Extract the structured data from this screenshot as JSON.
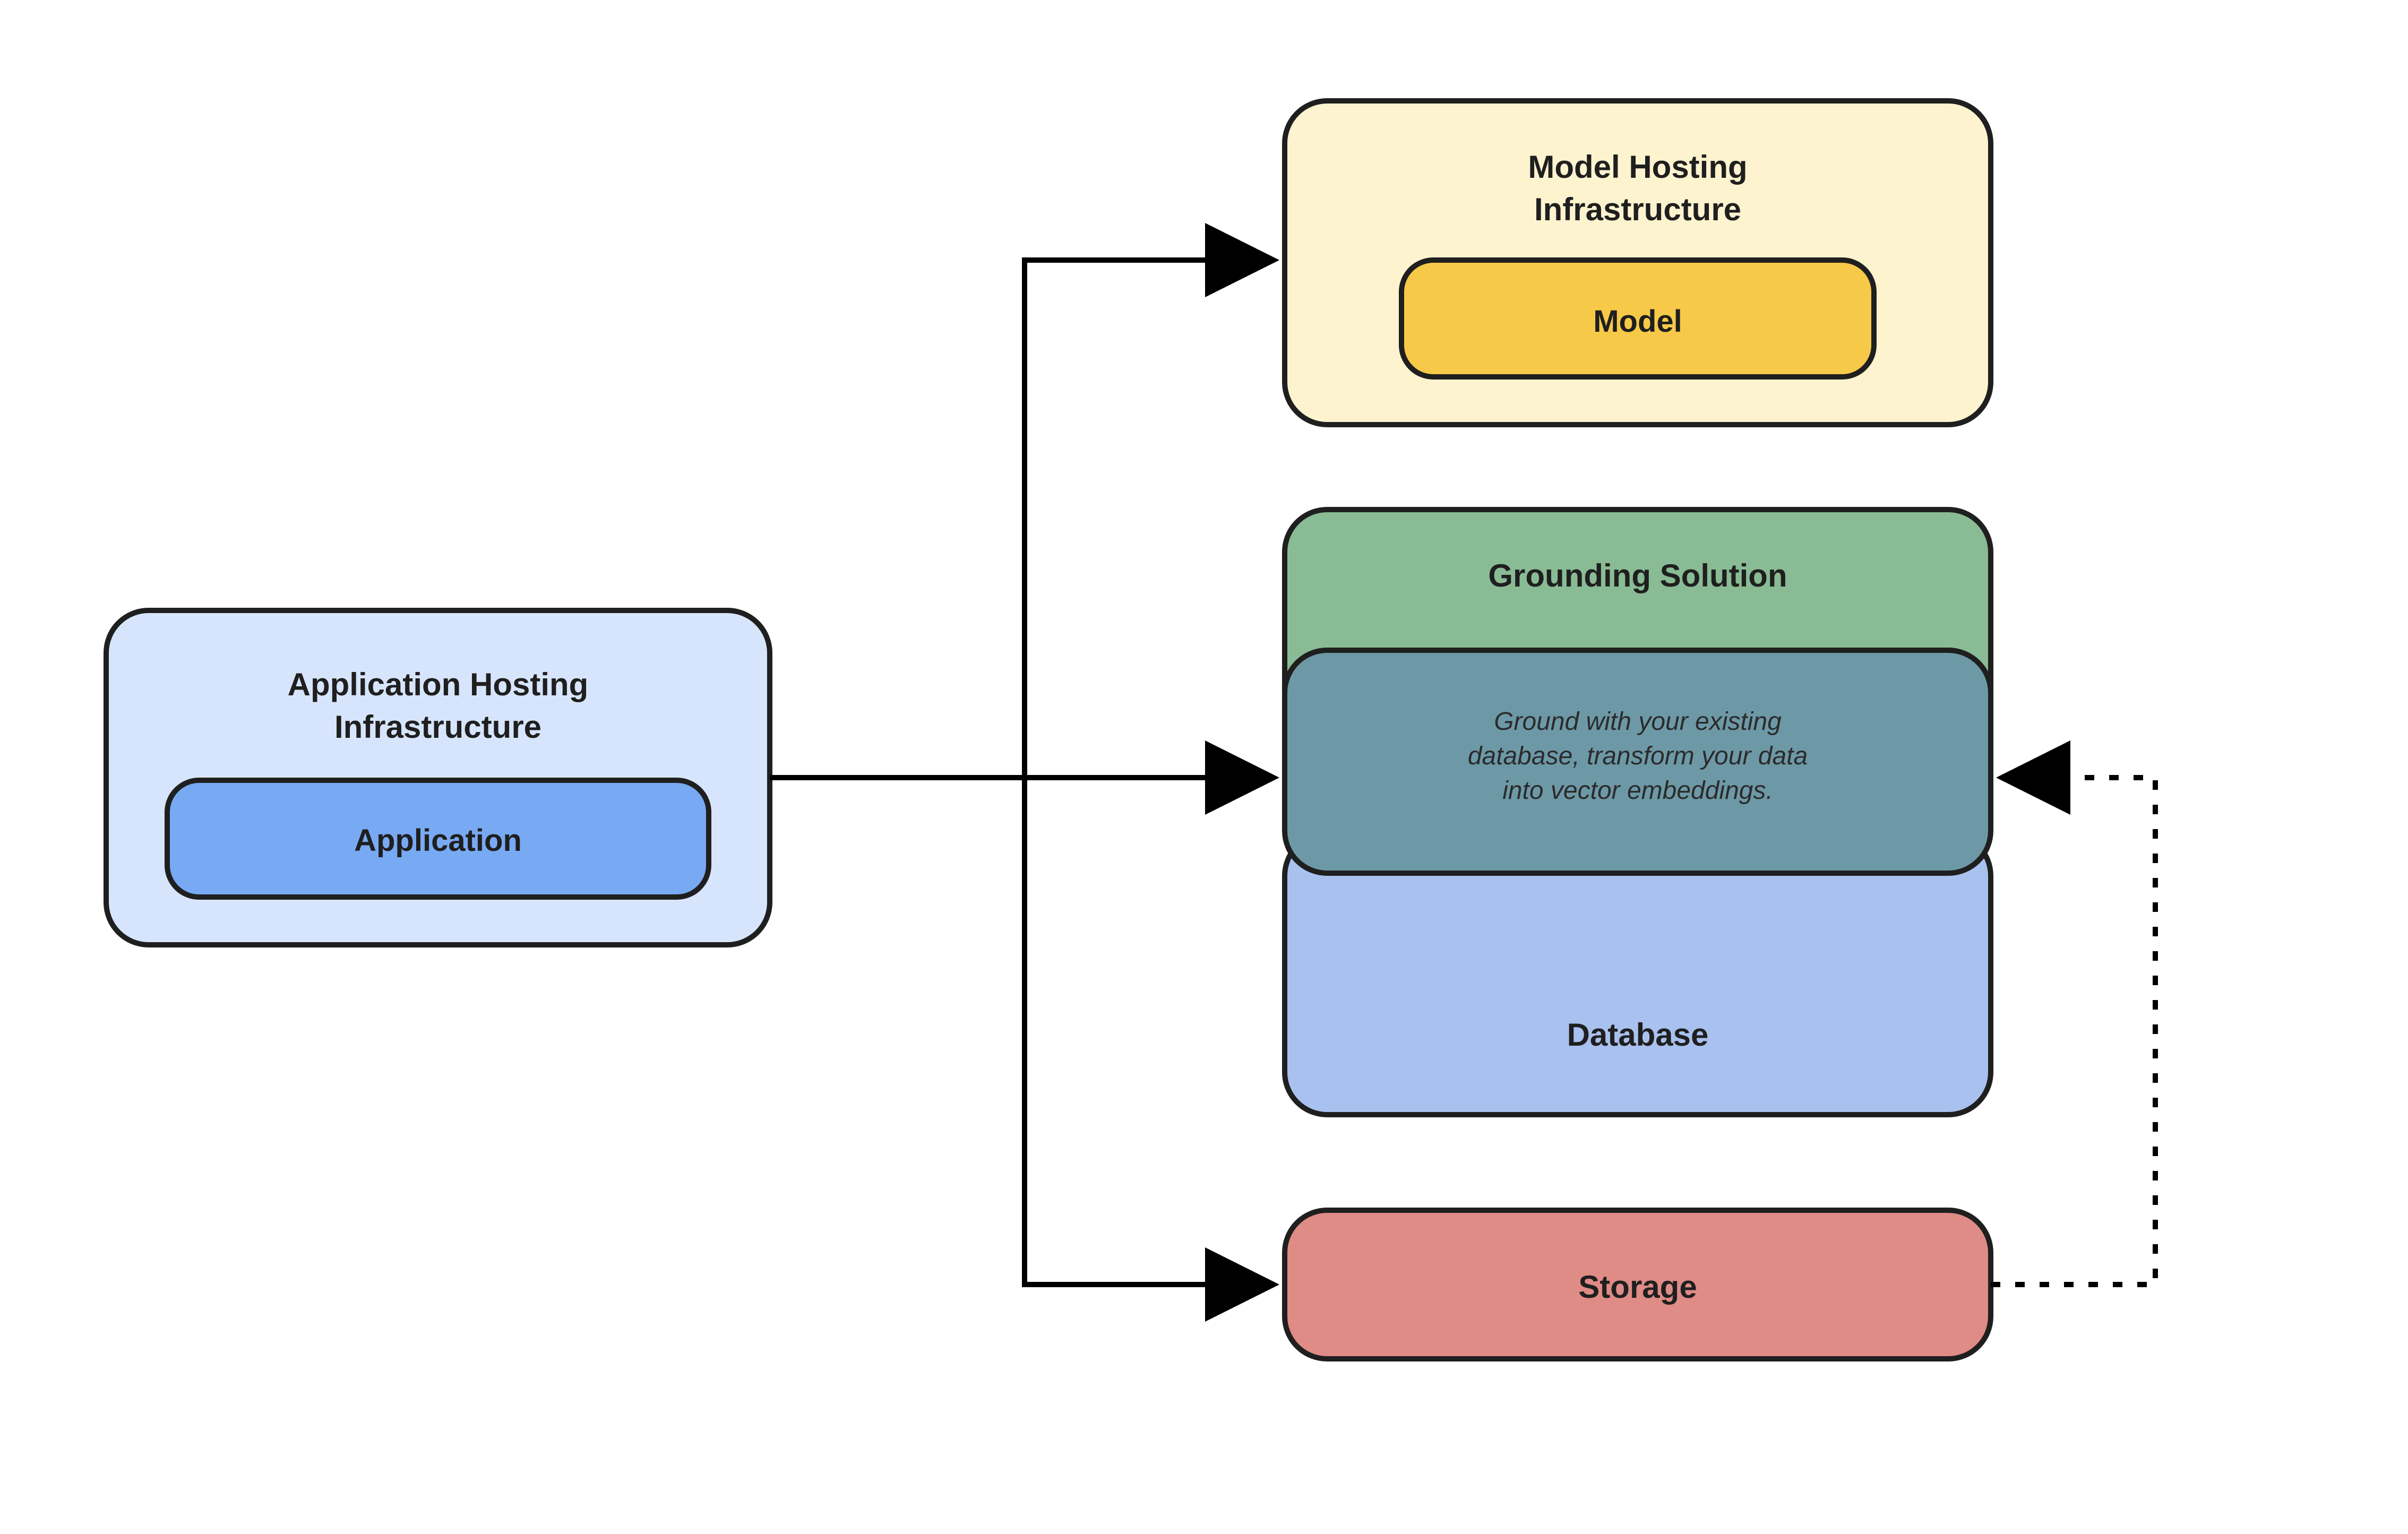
{
  "app_host": {
    "title_l1": "Application Hosting",
    "title_l2": "Infrastructure",
    "inner": "Application"
  },
  "model_host": {
    "title_l1": "Model Hosting",
    "title_l2": "Infrastructure",
    "inner": "Model"
  },
  "grounding": {
    "title": "Grounding Solution",
    "caption_l1": "Ground with your existing",
    "caption_l2": "database, transform your data",
    "caption_l3": "into vector embeddings."
  },
  "database": {
    "title": "Database"
  },
  "storage": {
    "title": "Storage"
  },
  "colors": {
    "app_bg": "#d7e5fc",
    "app_inner": "#78a9f3",
    "model_bg": "#fdf3cf",
    "model_inner": "#f7c948",
    "grounding_bg": "#89bb94",
    "overlap_bg": "#6d99a7",
    "database_bg": "#a9c1ee",
    "storage_bg": "#df8b86",
    "stroke": "#1f1f1f"
  },
  "chart_data": {
    "type": "flow-diagram",
    "nodes": [
      {
        "id": "app_host",
        "label": "Application Hosting Infrastructure",
        "children": [
          "application"
        ]
      },
      {
        "id": "application",
        "label": "Application",
        "parent": "app_host"
      },
      {
        "id": "model_host",
        "label": "Model Hosting Infrastructure",
        "children": [
          "model"
        ]
      },
      {
        "id": "model",
        "label": "Model",
        "parent": "model_host"
      },
      {
        "id": "grounding",
        "label": "Grounding Solution",
        "caption": "Ground with your existing database, transform your data into vector embeddings."
      },
      {
        "id": "database",
        "label": "Database",
        "overlaps": "grounding"
      },
      {
        "id": "storage",
        "label": "Storage"
      }
    ],
    "edges": [
      {
        "from": "app_host",
        "to": "model_host",
        "style": "solid"
      },
      {
        "from": "app_host",
        "to": "grounding",
        "style": "solid"
      },
      {
        "from": "app_host",
        "to": "storage",
        "style": "solid"
      },
      {
        "from": "storage",
        "to": "grounding",
        "style": "dashed"
      }
    ]
  }
}
